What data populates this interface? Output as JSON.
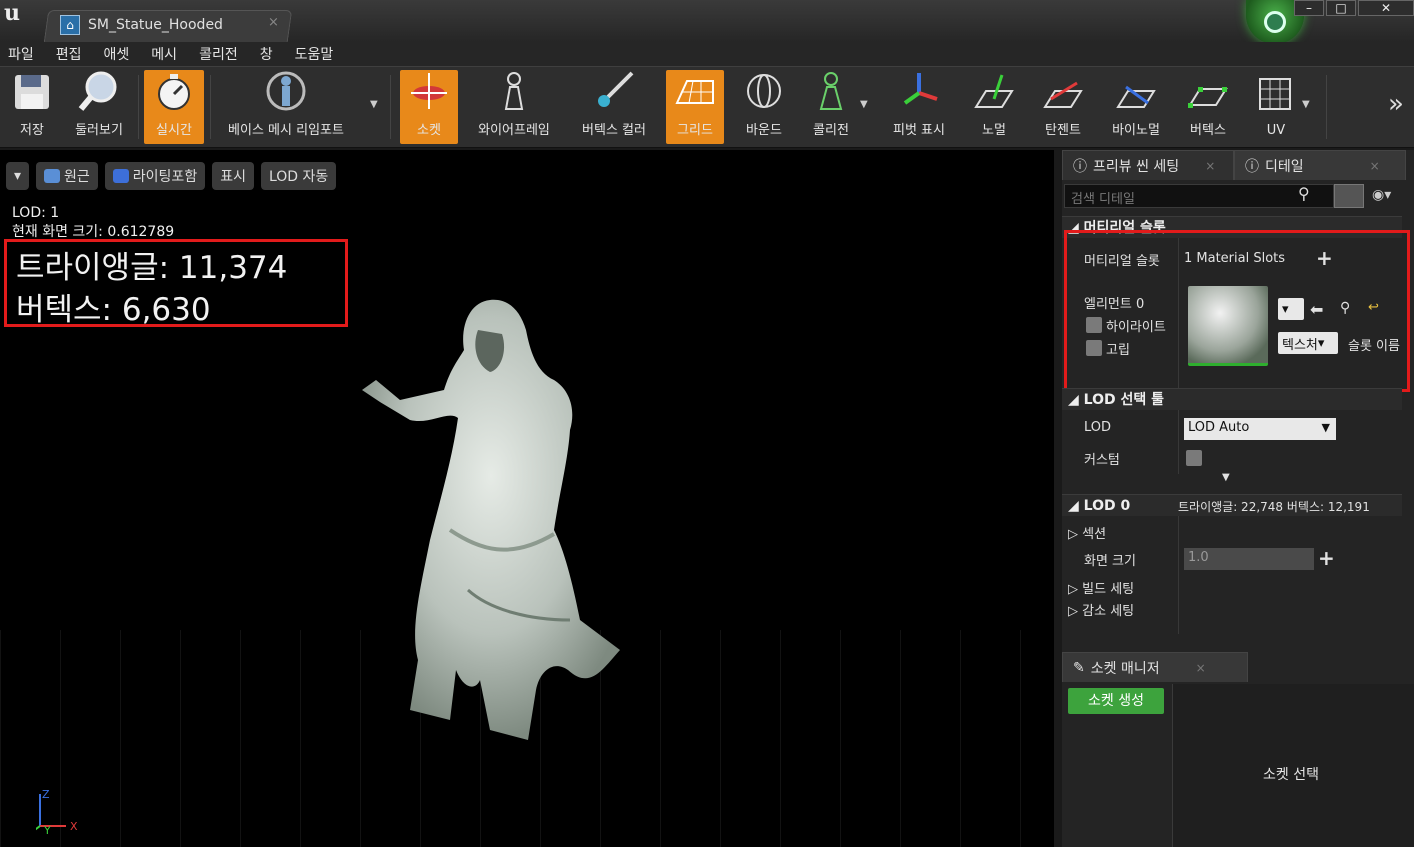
{
  "window": {
    "tab_title": "SM_Statue_Hooded",
    "tab_close": "×",
    "win_minimize": "–",
    "win_maximize": "□",
    "win_close": "✕"
  },
  "menu": [
    "파일",
    "편집",
    "애셋",
    "메시",
    "콜리전",
    "창",
    "도움말"
  ],
  "toolbar": {
    "save": "저장",
    "browse": "둘러보기",
    "realtime": "실시간",
    "reimport": "베이스 메시 리임포트",
    "socket": "소켓",
    "wireframe": "와이어프레임",
    "vertex_color": "버텍스 컬러",
    "grid": "그리드",
    "bounds": "바운드",
    "collision": "콜리전",
    "pivot": "피벗 표시",
    "normal": "노멀",
    "tangent": "탄젠트",
    "binormal": "바이노멀",
    "vertex": "버텍스",
    "uv": "UV",
    "more": "»"
  },
  "viewport": {
    "btn_perspective": "원근",
    "btn_lit": "라이팅포함",
    "btn_show": "표시",
    "btn_lod": "LOD 자동",
    "lod_line": "LOD:  1",
    "screen_size_line": "현재 화면 크기: 0.612789",
    "triangles": "트라이앵글: 11,374",
    "vertices": "버텍스: 6,630",
    "axis_z": "Z",
    "axis_y": "Y",
    "axis_x": "X"
  },
  "panel": {
    "tab_preview": "프리뷰 씬 세팅",
    "tab_details": "디테일",
    "search_placeholder": "검색 디테일",
    "mat_section": "머티리얼 슬롯",
    "mat_slots_label": "머티리얼 슬롯",
    "mat_slots_value": "1 Material Slots",
    "element0": "엘리먼트 0",
    "highlight": "하이라이트",
    "isolate": "고립",
    "texture_btn": "텍스처",
    "slot_name": "슬롯 이름",
    "lod_picker_section": "LOD 선택 툴",
    "lod_label": "LOD",
    "lod_value": "LOD Auto",
    "custom_label": "커스텀",
    "lod0_section": "LOD 0",
    "lod0_stats": "트라이앵글: 22,748   버텍스: 12,191",
    "sections": "섹션",
    "screen_size": "화면 크기",
    "screen_size_value": "1.0",
    "build_settings": "빌드 세팅",
    "reduction_settings": "감소 세팅"
  },
  "socket_manager": {
    "tab": "소켓 매니저",
    "create": "소켓 생성",
    "select": "소켓 선택"
  },
  "colors": {
    "accent_orange": "#e8891a",
    "highlight_red": "#e21b1b",
    "create_green": "#3da33d"
  }
}
